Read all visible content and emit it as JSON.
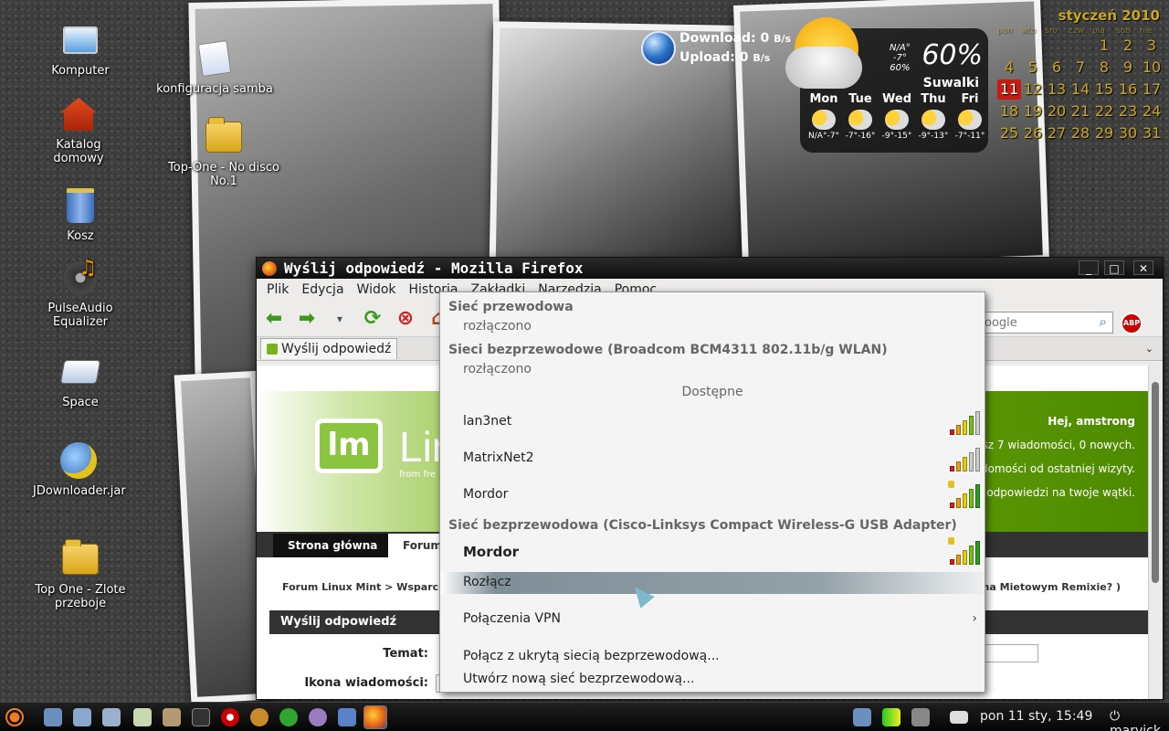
{
  "desktop": {
    "icons": [
      {
        "label": "Komputer",
        "icon": "computer-icon"
      },
      {
        "label": "Katalog domowy",
        "icon": "home-folder-icon"
      },
      {
        "label": "Kosz",
        "icon": "trash-icon"
      },
      {
        "label": "PulseAudio Equalizer",
        "icon": "music-equalizer-icon"
      },
      {
        "label": "Space",
        "icon": "drive-icon"
      },
      {
        "label": "JDownloader.jar",
        "icon": "java-icon"
      },
      {
        "label": "Top One - Zlote przeboje",
        "icon": "folder-icon"
      },
      {
        "label": "konfiguracja samba",
        "icon": "file-icon"
      },
      {
        "label": "Top-One - No disco No.1",
        "icon": "folder-icon"
      }
    ]
  },
  "netmon": {
    "download_label": "Download: 0",
    "upload_label": "Upload: 0",
    "unit": "B/s"
  },
  "weather": {
    "current_na": "N/A°",
    "current_temp": "-7°",
    "current_pct": "60%",
    "humidity": "60%",
    "city": "Suwalki",
    "days": [
      {
        "name": "Mon",
        "temps": "N/A°-7°"
      },
      {
        "name": "Tue",
        "temps": "-7°-16°"
      },
      {
        "name": "Wed",
        "temps": "-9°-15°"
      },
      {
        "name": "Thu",
        "temps": "-9°-13°"
      },
      {
        "name": "Fri",
        "temps": "-7°-11°"
      }
    ]
  },
  "calendar": {
    "month": "styczeń 2010",
    "day_headers": [
      "pon",
      "wto",
      "śro",
      "czw",
      "pią",
      "sob",
      "nie"
    ],
    "today": "11",
    "weeks": [
      [
        "",
        "",
        "",
        "",
        "1",
        "2",
        "3"
      ],
      [
        "4",
        "5",
        "6",
        "7",
        "8",
        "9",
        "10"
      ],
      [
        "11",
        "12",
        "13",
        "14",
        "15",
        "16",
        "17"
      ],
      [
        "18",
        "19",
        "20",
        "21",
        "22",
        "23",
        "24"
      ],
      [
        "25",
        "26",
        "27",
        "28",
        "29",
        "30",
        "31"
      ]
    ]
  },
  "firefox": {
    "title": "Wyślij odpowiedź - Mozilla Firefox",
    "menu": [
      "Plik",
      "Edycja",
      "Widok",
      "Historia",
      "Zakładki",
      "Narzędzia",
      "Pomoc"
    ],
    "search_placeholder": "oogle",
    "abp": "ABP",
    "tab_label": "Wyślij odpowiedź",
    "page": {
      "logo_text": "lm",
      "logo_name": "Linu",
      "logo_sub": "from fre",
      "greeting": "Hej, amstrong",
      "greet_lines": [
        "asz 7 wiadomości, 0 nowych.",
        "adomości od ostatniej wizyty.",
        "e odpowiedzi na twoje wątki."
      ],
      "nav_tabs": [
        "Strona główna",
        "Forum"
      ],
      "breadcrumb": "Forum Linux Mint  >  Wsparcie",
      "breadcrumb_tail": "C na Mietowym Remixie? )",
      "reply_header": "Wyślij odpowiedź",
      "field_topic": "Temat:",
      "field_icon": "Ikona wiadomości:"
    }
  },
  "network_menu": {
    "wired_header": "Sieć przewodowa",
    "wired_status": "rozłączono",
    "wireless1_header": "Sieci bezprzewodowe (Broadcom BCM4311 802.11b/g WLAN)",
    "wireless1_status": "rozłączono",
    "available": "Dostępne",
    "networks": [
      {
        "name": "lan3net",
        "signal": 0.8,
        "locked": false
      },
      {
        "name": "MatrixNet2",
        "signal": 0.6,
        "locked": false
      },
      {
        "name": "Mordor",
        "signal": 1.0,
        "locked": true
      }
    ],
    "wireless2_header": "Sieć bezprzewodowa (Cisco-Linksys Compact Wireless-G USB Adapter)",
    "active_network": "Mordor",
    "disconnect": "Rozłącz",
    "vpn": "Połączenia VPN",
    "hidden": "Połącz z ukrytą siecią bezprzewodową...",
    "new": "Utwórz nową sieć bezprzewodową..."
  },
  "taskbar": {
    "clock": "pon 11 sty, 15:49",
    "user": "marvick"
  }
}
